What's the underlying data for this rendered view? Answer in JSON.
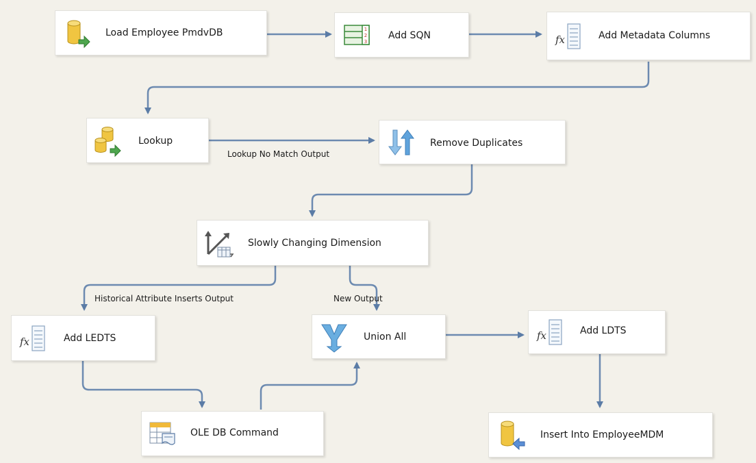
{
  "nodes": {
    "load_employee": {
      "label": "Load Employee PmdvDB",
      "icon": "db-source-icon"
    },
    "add_sqn": {
      "label": "Add SQN",
      "icon": "row-number-icon"
    },
    "add_metadata": {
      "label": "Add Metadata Columns",
      "icon": "derived-column-icon"
    },
    "lookup": {
      "label": "Lookup",
      "icon": "lookup-icon"
    },
    "remove_duplicates": {
      "label": "Remove Duplicates",
      "icon": "sort-icon"
    },
    "scd": {
      "label": "Slowly Changing Dimension",
      "icon": "scd-icon"
    },
    "add_ledts": {
      "label": "Add LEDTS",
      "icon": "derived-column-icon"
    },
    "union_all": {
      "label": "Union All",
      "icon": "union-all-icon"
    },
    "add_ldts": {
      "label": "Add LDTS",
      "icon": "derived-column-icon"
    },
    "ole_db_command": {
      "label": "OLE DB Command",
      "icon": "ole-db-command-icon"
    },
    "insert_employee": {
      "label": "Insert Into EmployeeMDM",
      "icon": "db-destination-icon"
    }
  },
  "paths": {
    "lookup_no_match": "Lookup No Match Output",
    "historical_inserts": "Historical Attribute Inserts Output",
    "new_output": "New Output"
  },
  "colors": {
    "canvas": "#f3f1ea",
    "arrow": "#5b7ca6",
    "node_bg": "#ffffff"
  }
}
